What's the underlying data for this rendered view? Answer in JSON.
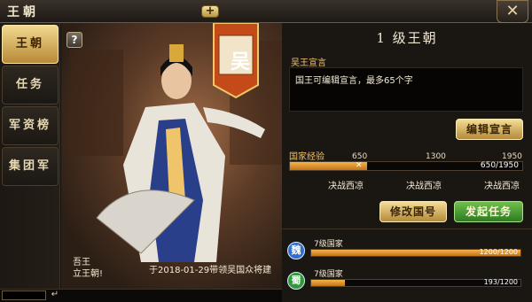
{
  "window": {
    "title": "王朝",
    "add_icon": "plus-icon",
    "close_icon": "close-icon"
  },
  "sidebar": {
    "items": [
      {
        "label": "王朝",
        "active": true
      },
      {
        "label": "任务",
        "active": false
      },
      {
        "label": "军资榜",
        "active": false
      },
      {
        "label": "集团军",
        "active": false
      }
    ]
  },
  "portrait": {
    "help_label": "?",
    "banner_char": "吴",
    "caption_left_1": "吾王",
    "caption_left_2": "立王朝!",
    "caption_right": "于2018-01-29带领吴国众将建"
  },
  "dynasty": {
    "level_title": "1 级王朝",
    "declaration_label": "吴王宣言",
    "declaration_text": "国王可编辑宣言，最多65个字",
    "edit_button": "编辑宣言",
    "exp_label": "国家经验",
    "ticks": [
      "650",
      "1300",
      "1950"
    ],
    "exp_current": 650,
    "exp_max": 1950,
    "exp_text": "650/1950",
    "milestones": [
      "决战西凉",
      "决战西凉",
      "决战西凉"
    ],
    "rename_button": "修改国号",
    "launch_button": "发起任务"
  },
  "nations": [
    {
      "icon_char": "魏",
      "color": "#2f6fd0",
      "label": "7级国家",
      "value": 1200,
      "max": 1200,
      "text": "1200/1200"
    },
    {
      "icon_char": "蜀",
      "color": "#2e9a3a",
      "label": "7级国家",
      "value": 193,
      "max": 1200,
      "text": "193/1200"
    }
  ],
  "colors": {
    "accent_gold": "#f2c26a",
    "bar_orange": "#e89a34"
  }
}
